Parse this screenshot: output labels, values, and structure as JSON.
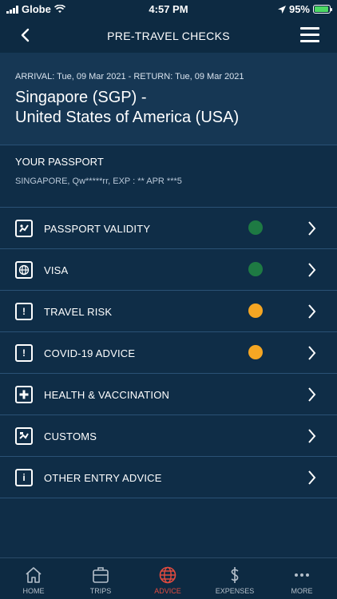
{
  "status_bar": {
    "carrier": "Globe",
    "time": "4:57 PM",
    "battery": "95%",
    "battery_level": 0.95
  },
  "nav": {
    "title": "PRE-TRAVEL CHECKS"
  },
  "trip": {
    "dates": "ARRIVAL: Tue, 09 Mar 2021 - RETURN: Tue, 09 Mar 2021",
    "route_line1": "Singapore (SGP) -",
    "route_line2": "United States of America (USA)"
  },
  "passport": {
    "heading": "YOUR PASSPORT",
    "details": "SINGAPORE, Qw*****rr, EXP : ** APR ***5"
  },
  "checks": [
    {
      "label": "PASSPORT VALIDITY",
      "icon": "passport-validity-icon",
      "status": "green"
    },
    {
      "label": "VISA",
      "icon": "visa-icon",
      "status": "green"
    },
    {
      "label": "TRAVEL RISK",
      "icon": "travel-risk-icon",
      "status": "amber"
    },
    {
      "label": "COVID-19 ADVICE",
      "icon": "covid-advice-icon",
      "status": "amber"
    },
    {
      "label": "HEALTH & VACCINATION",
      "icon": "health-icon",
      "status": "none"
    },
    {
      "label": "CUSTOMS",
      "icon": "customs-icon",
      "status": "none"
    },
    {
      "label": "OTHER ENTRY ADVICE",
      "icon": "info-icon",
      "status": "none"
    }
  ],
  "colors": {
    "background": "#0f2d47",
    "header": "#163754",
    "green": "#1e7a43",
    "amber": "#f5a623",
    "active_tab": "#e24b3f"
  },
  "tabs": [
    {
      "label": "HOME",
      "icon": "home-icon"
    },
    {
      "label": "TRIPS",
      "icon": "suitcase-icon"
    },
    {
      "label": "ADVICE",
      "icon": "globe-icon",
      "active": true
    },
    {
      "label": "EXPENSES",
      "icon": "dollar-icon"
    },
    {
      "label": "MORE",
      "icon": "more-icon"
    }
  ]
}
